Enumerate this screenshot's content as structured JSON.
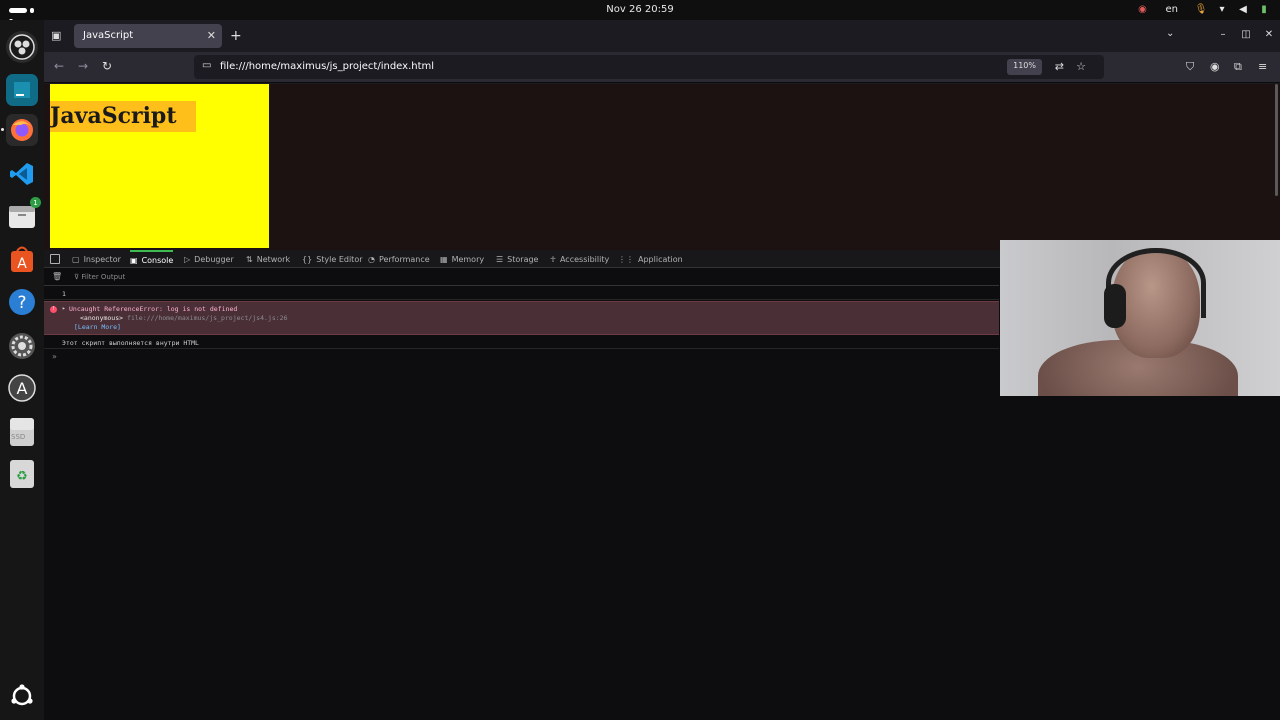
{
  "system": {
    "clock": "Nov 26  20:59",
    "lang": "en"
  },
  "dock": {
    "items": [
      {
        "name": "obs",
        "icon": "obs-icon"
      },
      {
        "name": "jetbrains",
        "icon": "ide-icon"
      },
      {
        "name": "firefox",
        "icon": "firefox-icon"
      },
      {
        "name": "vscode",
        "icon": "vscode-icon"
      },
      {
        "name": "files",
        "icon": "files-icon",
        "badge": "1"
      },
      {
        "name": "app-center",
        "icon": "app-center-icon"
      },
      {
        "name": "help",
        "icon": "help-icon"
      },
      {
        "name": "settings",
        "icon": "settings-icon"
      },
      {
        "name": "software-updater",
        "icon": "updater-icon"
      },
      {
        "name": "ssd-drive",
        "icon": "drive-icon",
        "label": "SSD"
      },
      {
        "name": "trash",
        "icon": "trash-icon"
      },
      {
        "name": "show-apps",
        "icon": "ubuntu-icon"
      }
    ]
  },
  "browser": {
    "tab_title": "JavaScript",
    "url": "file:///home/maximus/js_project/index.html",
    "zoom": "110%"
  },
  "page": {
    "heading": "JavaScript",
    "box_color": "#ffff00",
    "heading_bg": "#ffbf1a"
  },
  "devtools": {
    "tabs": [
      {
        "label": "Inspector",
        "icon": "inspector-icon"
      },
      {
        "label": "Console",
        "icon": "console-icon",
        "active": true
      },
      {
        "label": "Debugger",
        "icon": "debugger-icon"
      },
      {
        "label": "Network",
        "icon": "network-icon"
      },
      {
        "label": "Style Editor",
        "icon": "style-editor-icon"
      },
      {
        "label": "Performance",
        "icon": "performance-icon"
      },
      {
        "label": "Memory",
        "icon": "memory-icon"
      },
      {
        "label": "Storage",
        "icon": "storage-icon"
      },
      {
        "label": "Accessibility",
        "icon": "accessibility-icon"
      },
      {
        "label": "Application",
        "icon": "application-icon"
      }
    ],
    "filter_placeholder": "Filter Output",
    "console": {
      "log1": "1",
      "error_message": "Uncaught ReferenceError: log is not defined",
      "error_frame": "<anonymous>",
      "error_location": "file:///home/maximus/js_project/js4.js:26",
      "learn_more": "[Learn More]",
      "log2": "Этот скрипт выполняется внутри HTML",
      "prompt": "»"
    }
  }
}
